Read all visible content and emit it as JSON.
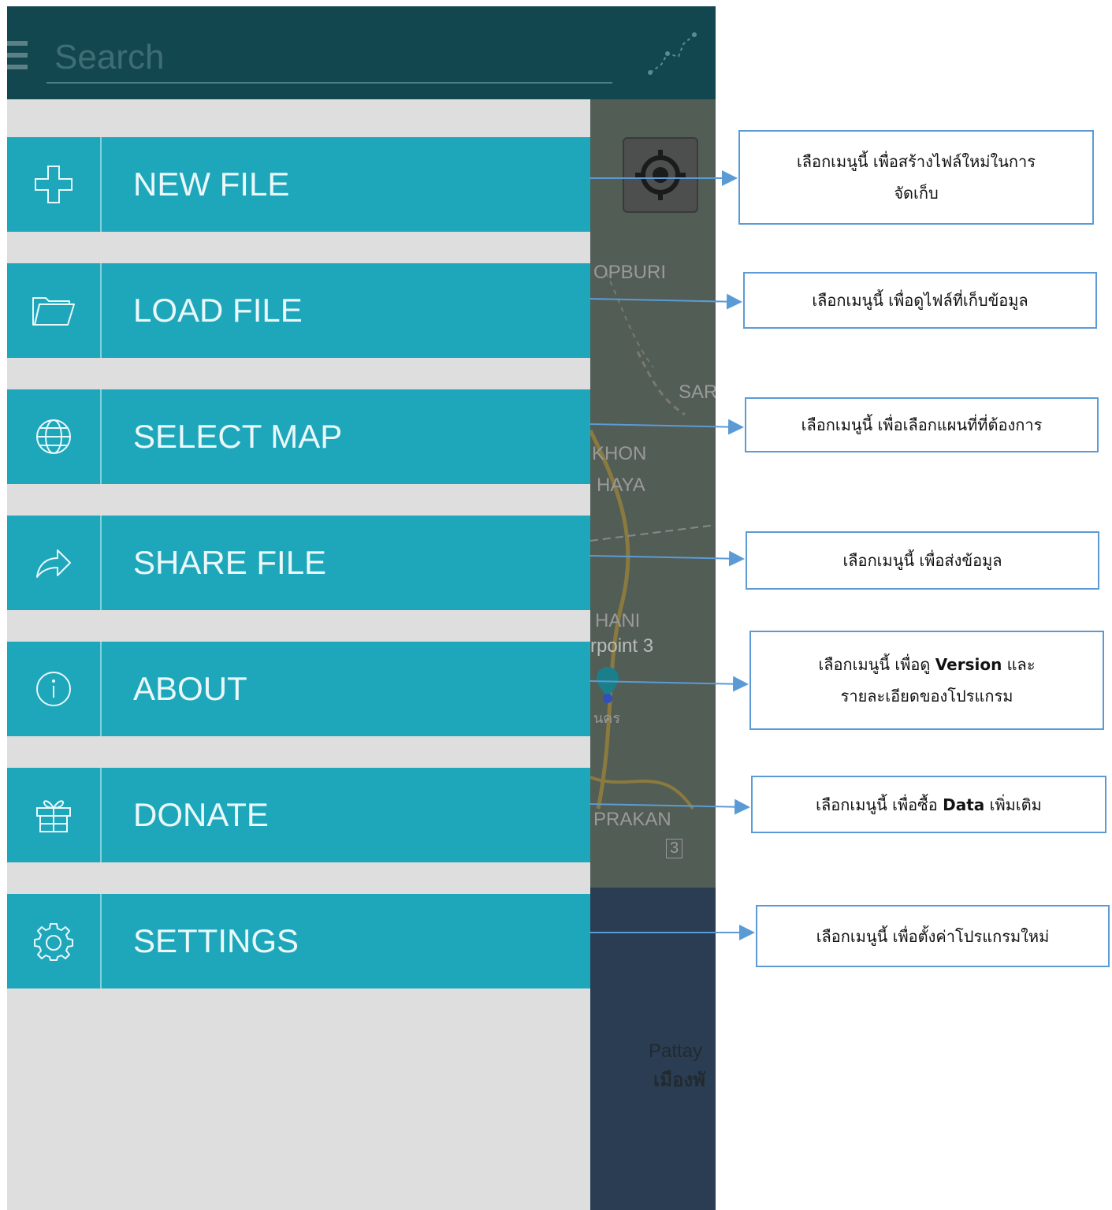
{
  "app": {
    "search": {
      "placeholder": "Search"
    }
  },
  "map": {
    "labels": [
      "OPBURI",
      "SAR",
      "KHON",
      "HAYA",
      "HANI",
      "rpoint 3",
      "นคร",
      "PRAKAN",
      "3",
      "Pattay",
      "เมืองพั"
    ]
  },
  "menu": {
    "items": [
      {
        "label": "NEW FILE",
        "icon": "plus-icon"
      },
      {
        "label": "LOAD FILE",
        "icon": "folder-icon"
      },
      {
        "label": "SELECT MAP",
        "icon": "globe-icon"
      },
      {
        "label": "SHARE FILE",
        "icon": "share-arrow-icon"
      },
      {
        "label": "ABOUT",
        "icon": "info-icon"
      },
      {
        "label": "DONATE",
        "icon": "gift-icon"
      },
      {
        "label": "SETTINGS",
        "icon": "gear-icon"
      }
    ]
  },
  "callouts": [
    {
      "line1": "เลือกเมนูนี้ เพื่อสร้างไฟล์ใหม่ในการ",
      "line2": "จัดเก็บ"
    },
    {
      "line1": "เลือกเมนูนี้ เพื่อดูไฟล์ที่เก็บข้อมูล"
    },
    {
      "line1": "เลือกเมนูนี้ เพื่อเลือกแผนที่ที่ต้องการ"
    },
    {
      "line1": "เลือกเมนูนี้ เพื่อส่งข้อมูล"
    },
    {
      "line1_pre": "เลือกเมนูนี้ เพื่อดู ",
      "line1_bold": "Version",
      "line1_post": " และ",
      "line2": "รายละเอียดของโปรแกรม"
    },
    {
      "line1_pre": "เลือกเมนูนี้ เพื่อซื้อ ",
      "line1_bold": "Data",
      "line1_post": " เพิ่มเติม"
    },
    {
      "line1": "เลือกเมนูนี้ เพื่อตั้งค่าโปรแกรมใหม่"
    }
  ],
  "colors": {
    "topbar": "#124750",
    "menu_item": "#1ea7bb",
    "drawer_bg": "#dedede",
    "callout_border": "#5b9bd5"
  }
}
